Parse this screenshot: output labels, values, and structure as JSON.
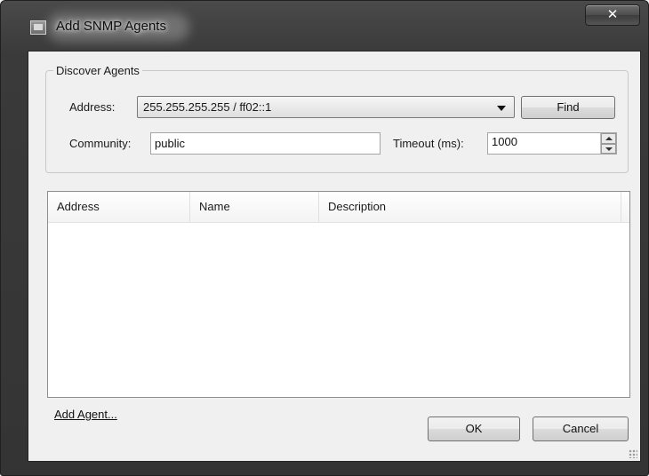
{
  "window": {
    "title": "Add SNMP Agents",
    "close_glyph": "✕"
  },
  "discover": {
    "legend": "Discover Agents",
    "address_label": "Address:",
    "address_value": "255.255.255.255 / ff02::1",
    "find_label": "Find",
    "community_label": "Community:",
    "community_value": "public",
    "timeout_label": "Timeout (ms):",
    "timeout_value": "1000"
  },
  "table": {
    "columns": [
      "Address",
      "Name",
      "Description"
    ],
    "rows": []
  },
  "footer": {
    "add_agent_link": "Add Agent...",
    "ok_label": "OK",
    "cancel_label": "Cancel"
  },
  "icons": {
    "title_icon": "snmp-app-icon",
    "combo_arrow": "chevron-down-icon",
    "spin": "spin-updown-icon",
    "grip": "resize-grip-icon"
  }
}
